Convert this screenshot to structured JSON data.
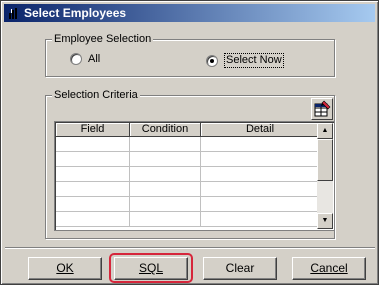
{
  "window": {
    "title": "Select Employees"
  },
  "employee_selection": {
    "label": "Employee Selection",
    "options": [
      {
        "label": "All",
        "selected": false
      },
      {
        "label": "Select Now",
        "selected": true
      }
    ]
  },
  "selection_criteria": {
    "label": "Selection Criteria",
    "columns": [
      "Field",
      "Condition",
      "Detail"
    ],
    "row_count": 6
  },
  "buttons": {
    "ok": "OK",
    "sql": "SQL",
    "clear": "Clear",
    "cancel": "Cancel"
  },
  "highlight_color": "#d6263b"
}
